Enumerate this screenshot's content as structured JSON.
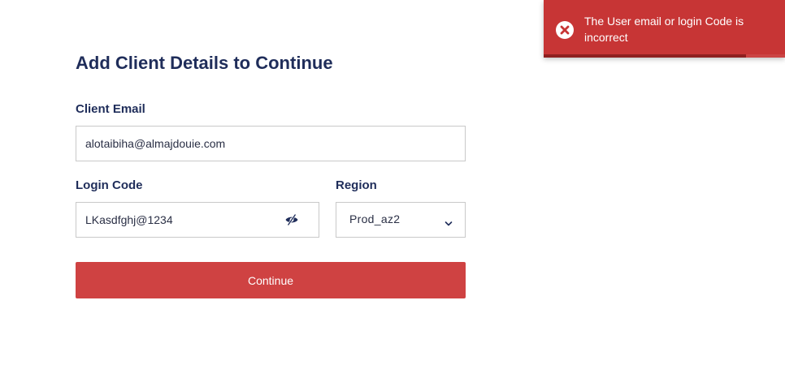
{
  "form": {
    "title": "Add Client Details to Continue",
    "email_label": "Client Email",
    "email_value": "alotaibiha@almajdouie.com",
    "code_label": "Login Code",
    "code_value": "LKasdfghj@1234",
    "region_label": "Region",
    "region_value": "Prod_az2",
    "continue_label": "Continue"
  },
  "toast": {
    "message": "The User email or login Code is incorrect",
    "progress": 0.84
  },
  "colors": {
    "heading": "#1f2d5a",
    "primary_button": "#cf4242",
    "toast_background": "#c73535",
    "toast_progress": "#8e1f1f"
  },
  "icons": {
    "toast": "error-circle-x-icon",
    "password_toggle": "eye-slash-icon",
    "region_dropdown": "chevron-down-icon"
  }
}
